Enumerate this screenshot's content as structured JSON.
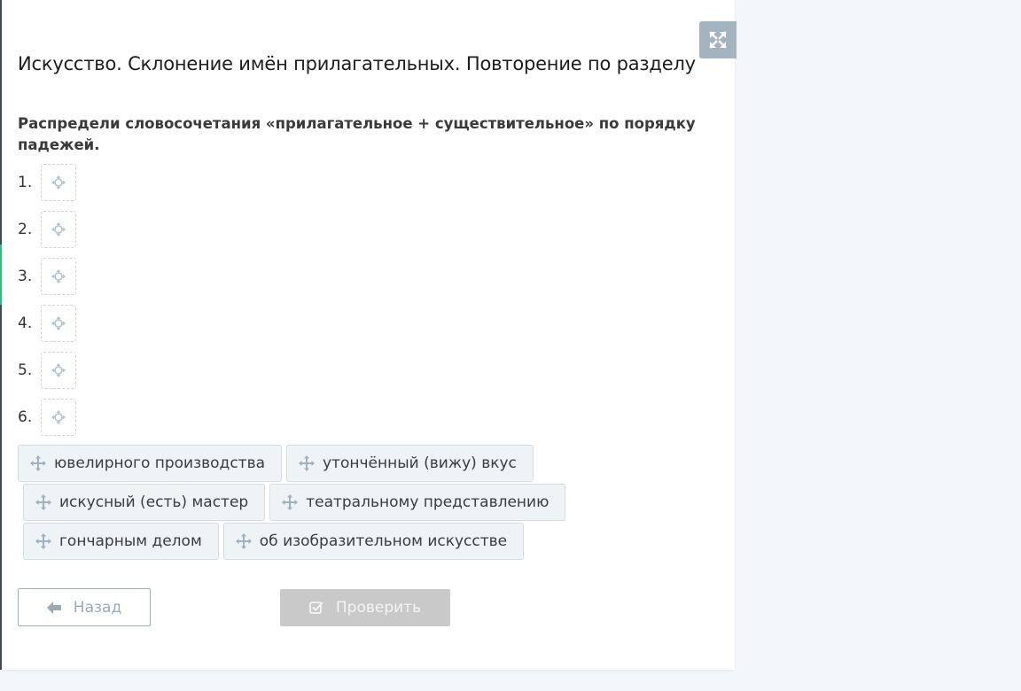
{
  "title": "Искусство. Склонение имён прилагательных. Повторение по разделу",
  "instruction": "Распредели словосочетания «прилагательное + существительное» по порядку падежей.",
  "icons": {
    "expand": "expand-icon",
    "slot": "move-icon",
    "chip": "move-icon",
    "back": "arrow-left-icon",
    "check": "check-square-icon"
  },
  "colors": {
    "accent": "#3cb878",
    "expand_bg": "#a3b3bf",
    "chip_bg": "#eef3f6",
    "check_disabled": "#c9c9c9"
  },
  "slots": [
    {
      "number": "1."
    },
    {
      "number": "2."
    },
    {
      "number": "3."
    },
    {
      "number": "4."
    },
    {
      "number": "5."
    },
    {
      "number": "6."
    }
  ],
  "chips": [
    "ювелирного производства",
    "утончённый (вижу) вкус",
    "искусный (есть) мастер",
    "театральному представлению",
    "гончарным делом",
    "об изобразительном искусстве"
  ],
  "buttons": {
    "back": "Назад",
    "check": "Проверить"
  }
}
